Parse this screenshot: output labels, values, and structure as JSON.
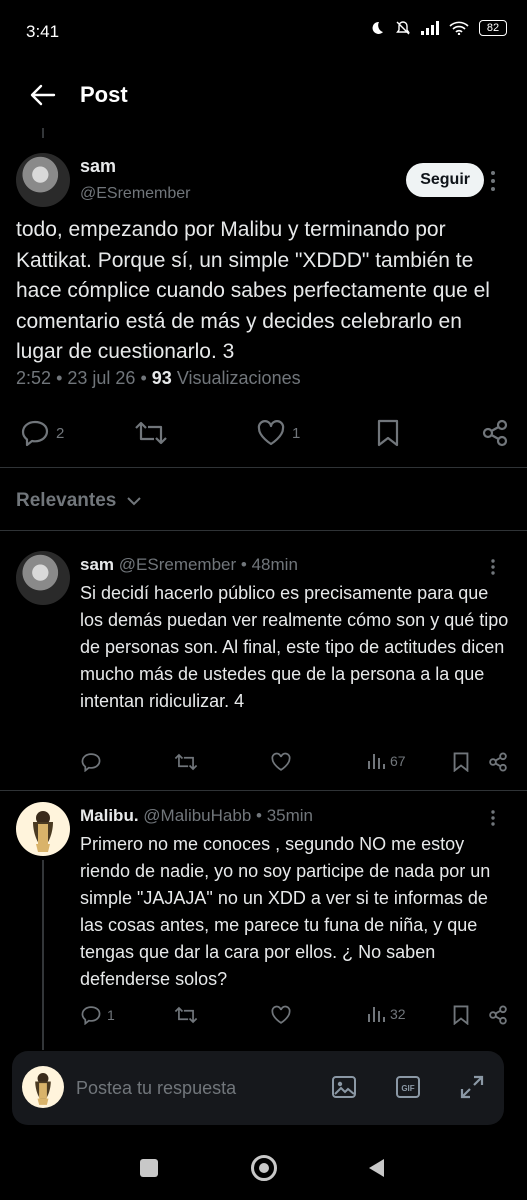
{
  "status_bar": {
    "time": "3:41",
    "battery": "82"
  },
  "header": {
    "title": "Post"
  },
  "main_post": {
    "name": "sam",
    "handle": "@ESremember",
    "follow_label": "Seguir",
    "text": "todo, empezando por Malibu y terminando por Kattikat. Porque sí, un simple \"XDDD\" también te hace cómplice cuando sabes perfectamente que el comentario está de más y decides celebrarlo en lugar de cuestionarlo. 3",
    "time": "2:52",
    "date": "23 jul 26",
    "views_count": "93",
    "views_label": "Visualizaciones",
    "replies": "2",
    "likes": "1"
  },
  "sort": {
    "label": "Relevantes"
  },
  "replies": [
    {
      "name": "sam",
      "handle": "@ESremember",
      "age": "48min",
      "text": "Si decidí hacerlo público es precisamente para que los demás puedan ver realmente cómo son y qué tipo de personas son. Al final, este tipo de actitudes dicen mucho más de ustedes que de la persona a la que intentan ridiculizar. 4",
      "replies": "",
      "views": "67"
    },
    {
      "name": "Malibu.",
      "handle": "@MalibuHabb",
      "age": "35min",
      "text": "Primero no me conoces , segundo NO me estoy riendo de nadie, yo no soy participe de nada por un simple \"JAJAJA\" no un XDD a ver si te informas de las cosas antes, me parece tu funa de niña, y que tengas que dar la cara por ellos. ¿ No saben defenderse solos?",
      "replies": "1",
      "views": "32"
    }
  ],
  "composer": {
    "placeholder": "Postea tu respuesta",
    "gif_label": "GIF"
  },
  "separator": "•"
}
